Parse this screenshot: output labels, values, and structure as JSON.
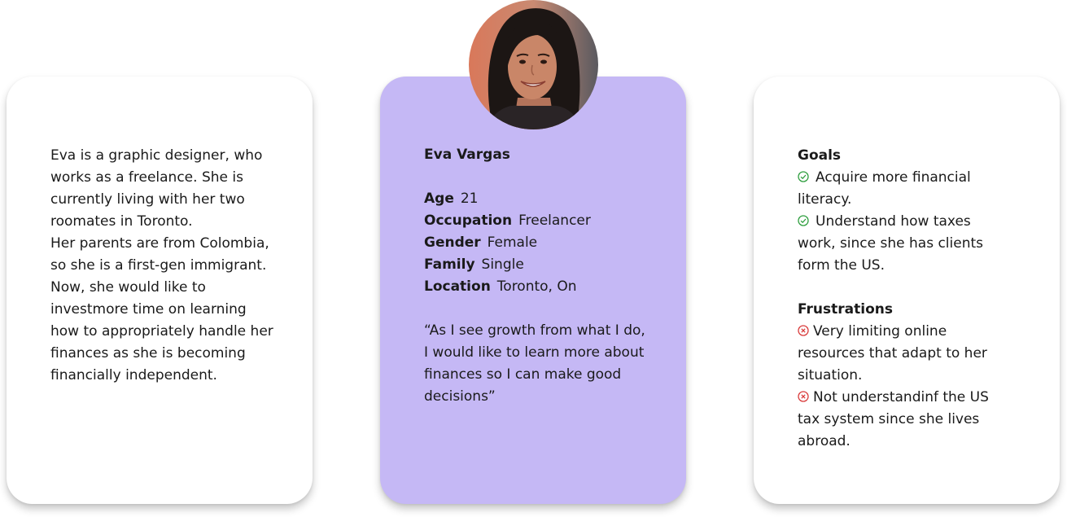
{
  "bio": {
    "paragraphs": [
      "Eva is a graphic designer, who works as a freelance. She is currently living with her two roomates in Toronto.",
      "Her parents are from Colombia, so she is a first-gen immigrant.",
      "Now, she would like to investmore time on learning how to appropriately handle her finances as she is becoming financially independent."
    ]
  },
  "profile": {
    "name": "Eva Vargas",
    "details": [
      {
        "label": "Age",
        "value": "21"
      },
      {
        "label": "Occupation",
        "value": "Freelancer"
      },
      {
        "label": "Gender",
        "value": "Female"
      },
      {
        "label": "Family",
        "value": "Single"
      },
      {
        "label": "Location",
        "value": "Toronto, On"
      }
    ],
    "quote": "“As I see growth from what I do, I would like to learn more about finances so I can make good decisions”"
  },
  "goals": {
    "title": "Goals",
    "icon": "check-circle-icon",
    "color": "#2e9e3e",
    "items": [
      "Acquire more financial literacy.",
      "Understand how taxes work, since she has clients form the US."
    ]
  },
  "frustrations": {
    "title": "Frustrations",
    "icon": "x-circle-icon",
    "color": "#d93b3b",
    "items": [
      "Very limiting online resources that adapt to her situation.",
      "Not understandinf the US tax system since she lives abroad."
    ]
  },
  "colors": {
    "center_card": "#c5b8f5"
  }
}
